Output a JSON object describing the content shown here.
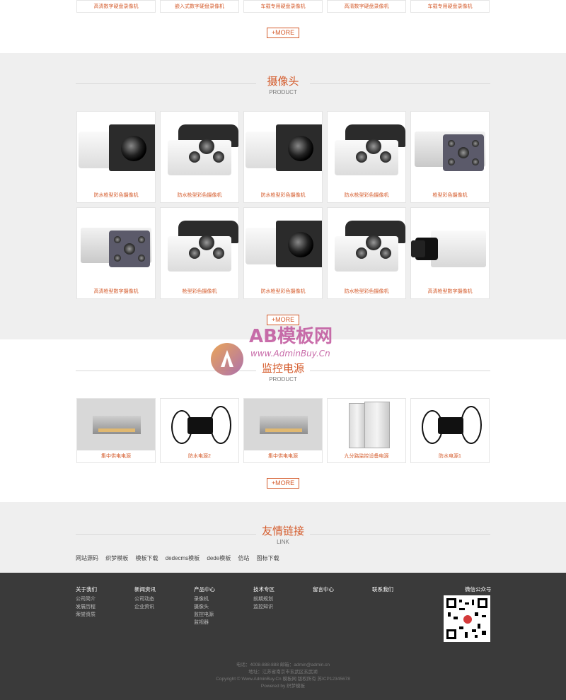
{
  "top_row": {
    "captions": [
      "高清数字硬盘录像机",
      "嵌入式数字硬盘录像机",
      "车载专用硬盘录像机",
      "高清数字硬盘录像机",
      "车载专用硬盘录像机"
    ],
    "more": "+MORE"
  },
  "camera_section": {
    "title": "摄像头",
    "subtitle": "PRODUCT",
    "row1": [
      "防水枪型彩色摄像机",
      "防水枪型彩色摄像机",
      "防水枪型彩色摄像机",
      "防水枪型彩色摄像机",
      "枪型彩色摄像机"
    ],
    "row2": [
      "高清枪型数字摄像机",
      "枪型彩色摄像机",
      "防水枪型彩色摄像机",
      "防水枪型彩色摄像机",
      "高清枪型数字摄像机"
    ],
    "more": "+MORE"
  },
  "power_section": {
    "title": "监控电源",
    "subtitle": "PRODUCT",
    "items": [
      "集中供电电源",
      "防水电源2",
      "集中供电电源",
      "九分路监控设备电源",
      "防水电源1"
    ],
    "more": "+MORE"
  },
  "watermark": {
    "brand": "AB模板网",
    "url": "www.AdminBuy.Cn"
  },
  "links_section": {
    "title": "友情链接",
    "subtitle": "LINK",
    "links": [
      "网站源码",
      "织梦模板",
      "模板下载",
      "dedecms模板",
      "dede模板",
      "仿站",
      "图标下载"
    ]
  },
  "footer": {
    "columns": [
      {
        "heading": "关于我们",
        "items": [
          "公司简介",
          "发展历程",
          "荣誉资质"
        ]
      },
      {
        "heading": "新闻资讯",
        "items": [
          "公司动态",
          "企业资讯"
        ]
      },
      {
        "heading": "产品中心",
        "items": [
          "录像机",
          "摄像头",
          "监控电源",
          "监视器"
        ]
      },
      {
        "heading": "技术专区",
        "items": [
          "前期规划",
          "监控知识"
        ]
      },
      {
        "heading": "留言中心",
        "items": []
      },
      {
        "heading": "联系我们",
        "items": []
      }
    ],
    "wechat_label": "微信公众号",
    "copyright": [
      "电话：4008-888-888  邮箱：admin@admin.cn",
      "地址：江苏省南京市玄武区玄武湖",
      "Copyright © Www.AdminBuy.Cn 模板网 版权所有 苏ICP12345678",
      "Powered by 织梦模板"
    ]
  },
  "colors": {
    "accent": "#d45a2a",
    "gray_band": "#efefef",
    "footer_bg": "#3a3a3a"
  }
}
